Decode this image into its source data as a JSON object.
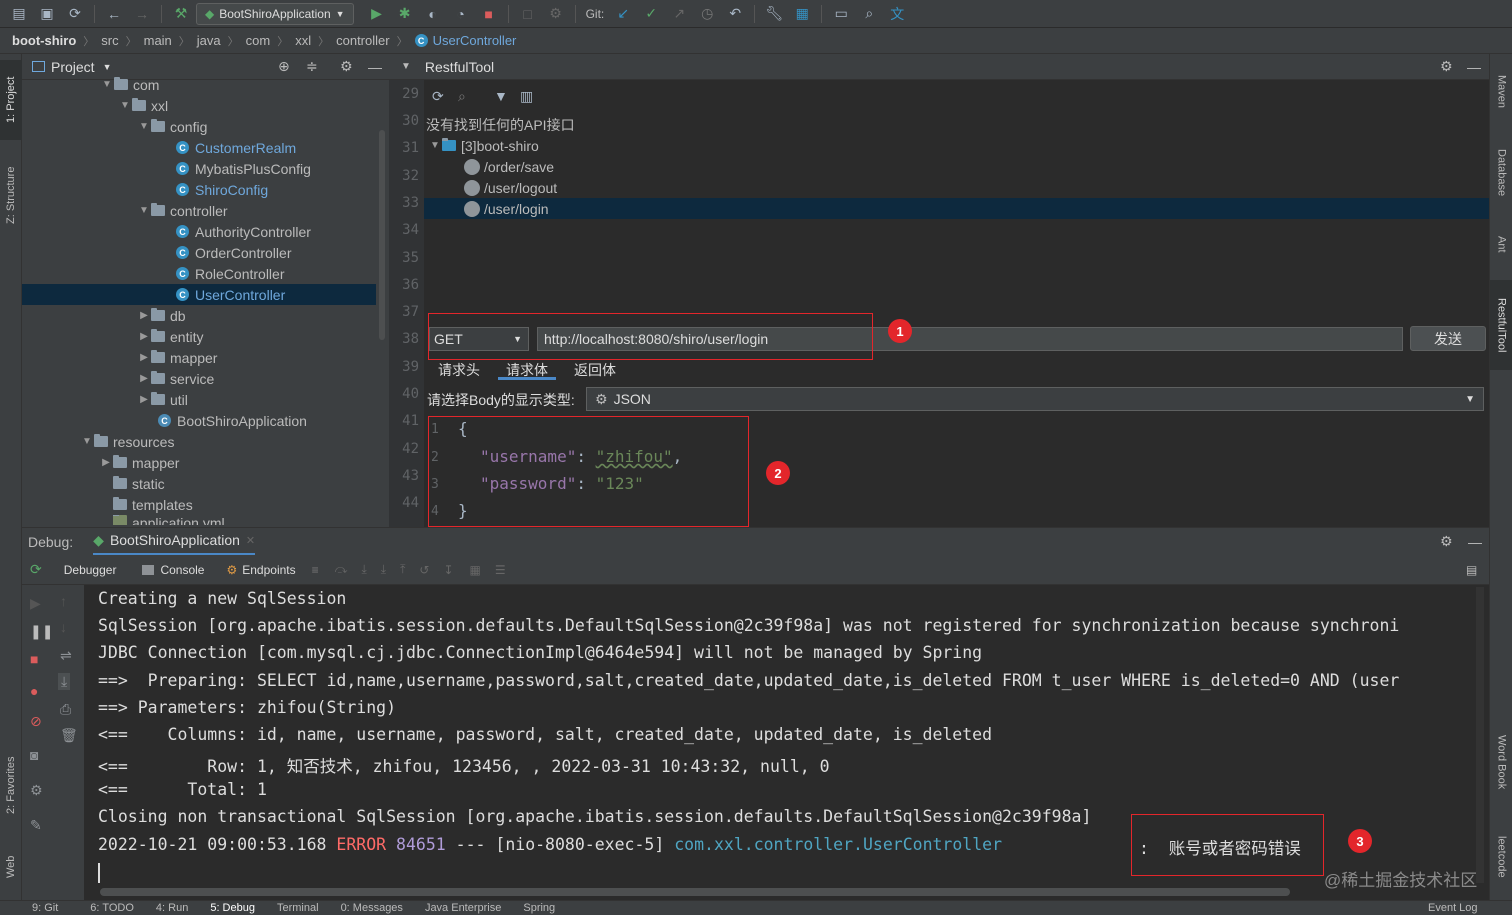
{
  "toolbar": {
    "run_config": "BootShiroApplication",
    "git_label": "Git:"
  },
  "breadcrumb": [
    "boot-shiro",
    "src",
    "main",
    "java",
    "com",
    "xxl",
    "controller"
  ],
  "breadcrumb_file": "UserController",
  "project": {
    "title": "Project",
    "tree": [
      "com",
      "xxl",
      "config",
      "CustomerRealm",
      "MybatisPlusConfig",
      "ShiroConfig",
      "controller",
      "AuthorityController",
      "OrderController",
      "RoleController",
      "UserController",
      "db",
      "entity",
      "mapper",
      "service",
      "util",
      "BootShiroApplication",
      "resources",
      "mapper",
      "static",
      "templates",
      "application.yml"
    ]
  },
  "left_stripe": {
    "project": "1: Project",
    "structure": "Z: Structure",
    "favorites": "2: Favorites",
    "web": "Web"
  },
  "right_stripe": {
    "maven": "Maven",
    "database": "Database",
    "ant": "Ant",
    "restful": "RestfulTool",
    "wordbook": "Word Book",
    "leetcode": "leetcode"
  },
  "editor": {
    "line_numbers": [
      "29",
      "30",
      "31",
      "32",
      "33",
      "34",
      "35",
      "36",
      "37",
      "38",
      "39",
      "40",
      "41",
      "42",
      "43",
      "44"
    ]
  },
  "restful": {
    "title": "RestfulTool",
    "no_api": "没有找到任何的API接口",
    "project": "[3]boot-shiro",
    "apis": [
      "/order/save",
      "/user/logout",
      "/user/login"
    ],
    "method": "GET",
    "url": "http://localhost:8080/shiro/user/login",
    "send": "发送",
    "tabs": [
      "请求头",
      "请求体",
      "返回体"
    ],
    "body_type_label": "请选择Body的显示类型:",
    "body_type": "JSON",
    "json_line_numbers": [
      "1",
      "2",
      "3",
      "4"
    ],
    "json_open": "{",
    "json_key1": "\"username\"",
    "json_val1": "\"zhifou\"",
    "json_key2": "\"password\"",
    "json_val2": "\"123\"",
    "json_close": "}"
  },
  "debug": {
    "label": "Debug:",
    "session": "BootShiroApplication",
    "tabs": [
      "Debugger",
      "Console",
      "Endpoints"
    ]
  },
  "console": {
    "lines": [
      "Creating a new SqlSession",
      "SqlSession [org.apache.ibatis.session.defaults.DefaultSqlSession@2c39f98a] was not registered for synchronization because synchroni",
      "JDBC Connection [com.mysql.cj.jdbc.ConnectionImpl@6464e594] will not be managed by Spring",
      "==>  Preparing: SELECT id,name,username,password,salt,created_date,updated_date,is_deleted FROM t_user WHERE is_deleted=0 AND (user",
      "==> Parameters: zhifou(String)",
      "<==    Columns: id, name, username, password, salt, created_date, updated_date, is_deleted",
      "<==        Row: 1, 知否技术, zhifou, 123456, , 2022-03-31 10:43:32, null, 0",
      "<==      Total: 1",
      "Closing non transactional SqlSession [org.apache.ibatis.session.defaults.DefaultSqlSession@2c39f98a]"
    ],
    "error_time": "2022-10-21 09:00:53.168",
    "error_level": "ERROR",
    "error_pid": "84651",
    "error_dashes": "---",
    "error_thread": "[nio-8080-exec-5]",
    "error_class": "com.xxl.controller.UserController",
    "error_msg": ":  账号或者密码错误"
  },
  "badges": [
    "1",
    "2",
    "3"
  ],
  "statusbar": [
    "9: Git",
    "6: TODO",
    "4: Run",
    "5: Debug",
    "Terminal",
    "0: Messages",
    "Java Enterprise",
    "Spring",
    "Event Log"
  ],
  "watermark": "@稀土掘金技术社区",
  "colors": {
    "accent": "#3592c4",
    "annotation_red": "#e3262b",
    "error": "#ff6b68"
  }
}
